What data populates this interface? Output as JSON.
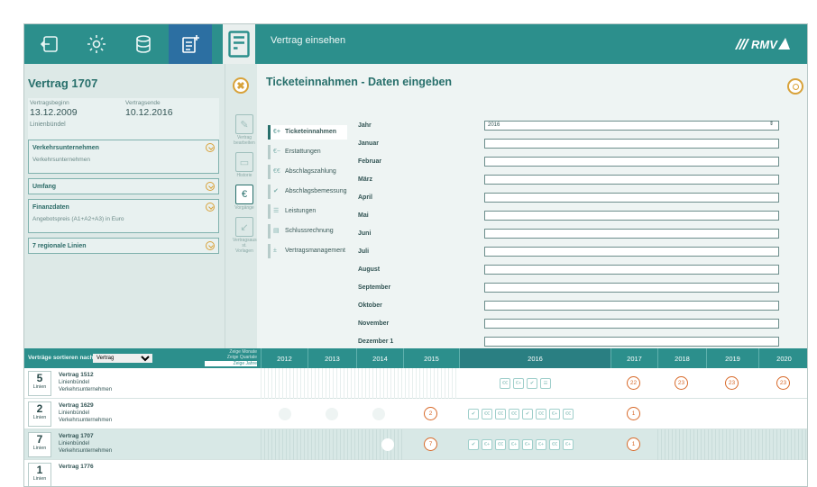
{
  "topbar": {
    "title": "Vertrag einsehen",
    "logo_text": "RMV",
    "icons": [
      "logout-icon",
      "gear-icon",
      "database-icon",
      "new-document-icon",
      "calculator-icon"
    ]
  },
  "left": {
    "title": "Vertrag 1707",
    "begin_label": "Vertragsbeginn",
    "begin_value": "13.12.2009",
    "end_label": "Vertragsende",
    "end_value": "10.12.2016",
    "type": "Linienbündel",
    "sections": [
      {
        "title": "Verkehrsunternehmen",
        "sub": "Verkehrsunternehmen"
      },
      {
        "title": "Umfang",
        "sub": ""
      },
      {
        "title": "Finanzdaten",
        "sub": "Angebotspreis (A1+A2+A3) in Euro"
      },
      {
        "title": "7 regionale Linien",
        "sub": ""
      }
    ]
  },
  "iconcol": {
    "items": [
      {
        "label": "Vertrag bearbeiten",
        "glyph": "✎"
      },
      {
        "label": "Historie",
        "glyph": "▭"
      },
      {
        "label": "Vorgänge",
        "glyph": "€"
      },
      {
        "label": "Vertragsaus-\nst. Vorlagen",
        "glyph": "↙"
      }
    ]
  },
  "main": {
    "title": "Ticketeinnahmen - Daten eingeben",
    "menu": [
      {
        "icon": "€+",
        "label": "Ticketeinnahmen"
      },
      {
        "icon": "€−",
        "label": "Erstattungen"
      },
      {
        "icon": "€€",
        "label": "Abschlagszahlung"
      },
      {
        "icon": "✔",
        "label": "Abschlagsbemessung"
      },
      {
        "icon": "☰",
        "label": "Leistungen"
      },
      {
        "icon": "▤",
        "label": "Schlussrechnung"
      },
      {
        "icon": "±",
        "label": "Vertragsmanagement"
      }
    ],
    "fields": [
      {
        "label": "Jahr",
        "value": "2016"
      },
      {
        "label": "Januar",
        "value": ""
      },
      {
        "label": "Februar",
        "value": ""
      },
      {
        "label": "März",
        "value": ""
      },
      {
        "label": "April",
        "value": ""
      },
      {
        "label": "Mai",
        "value": ""
      },
      {
        "label": "Juni",
        "value": ""
      },
      {
        "label": "Juli",
        "value": ""
      },
      {
        "label": "August",
        "value": ""
      },
      {
        "label": "September",
        "value": ""
      },
      {
        "label": "Oktober",
        "value": ""
      },
      {
        "label": "November",
        "value": ""
      },
      {
        "label": "Dezember 1",
        "value": ""
      }
    ]
  },
  "timeline": {
    "sort_label": "Verträge sortieren nach",
    "sort_value": "Vertrag",
    "view_options": [
      "Zeige Monate",
      "Zeige Quartale",
      "Zeige Jahre"
    ],
    "years": [
      "2012",
      "2013",
      "2014",
      "2015",
      "2016",
      "2017",
      "2018",
      "2019",
      "2020"
    ],
    "rows": [
      {
        "count": "5",
        "unit": "Linien",
        "name": "Vertrag 1512",
        "type": "Linienbündel",
        "company": "Verkehrsunternehmen"
      },
      {
        "count": "2",
        "unit": "Linien",
        "name": "Vertrag 1629",
        "type": "Linienbündel",
        "company": "Verkehrsunternehmen"
      },
      {
        "count": "7",
        "unit": "Linien",
        "name": "Vertrag 1707",
        "type": "Linienbündel",
        "company": "Verkehrsunternehmen"
      },
      {
        "count": "1",
        "unit": "Linien",
        "name": "Vertrag 1776",
        "type": "",
        "company": ""
      }
    ],
    "badges": {
      "r1": [
        "22",
        "23",
        "23",
        "23"
      ],
      "r2": [
        "2",
        "1"
      ],
      "r3": [
        "7",
        "1"
      ]
    }
  }
}
